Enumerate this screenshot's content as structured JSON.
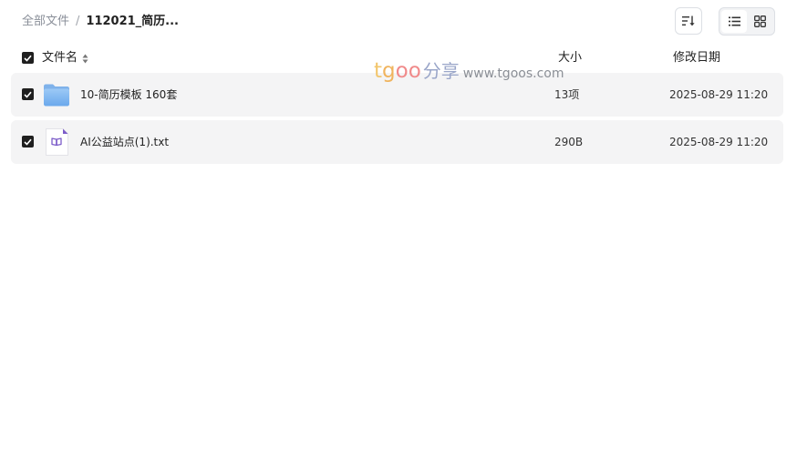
{
  "breadcrumb": {
    "root": "全部文件",
    "separator": "/",
    "current": "112021_简历..."
  },
  "toolbar": {
    "sort_icon": "sort-icon",
    "list_view_icon": "list-view-icon",
    "grid_view_icon": "grid-view-icon",
    "active_view": "list"
  },
  "table": {
    "columns": {
      "name": "文件名",
      "size": "大小",
      "date": "修改日期"
    },
    "rows": [
      {
        "name": "10-简历模板 160套",
        "size": "13项",
        "date": "2025-08-29 11:20",
        "icon": "folder-icon",
        "checked": true
      },
      {
        "name": "AI公益站点(1).txt",
        "size": "290B",
        "date": "2025-08-29 11:20",
        "icon": "text-file-icon",
        "checked": true
      }
    ]
  },
  "watermark": {
    "brand_t": "t",
    "brand_g": "g",
    "brand_oo": "oo",
    "brand_cn": "分享",
    "url": "www.tgoos.com"
  },
  "colors": {
    "row_bg": "#f4f4f5",
    "checkbox": "#1f1f1f",
    "folder": "#7fb5f0",
    "txt_icon": "#7c5cc9"
  }
}
